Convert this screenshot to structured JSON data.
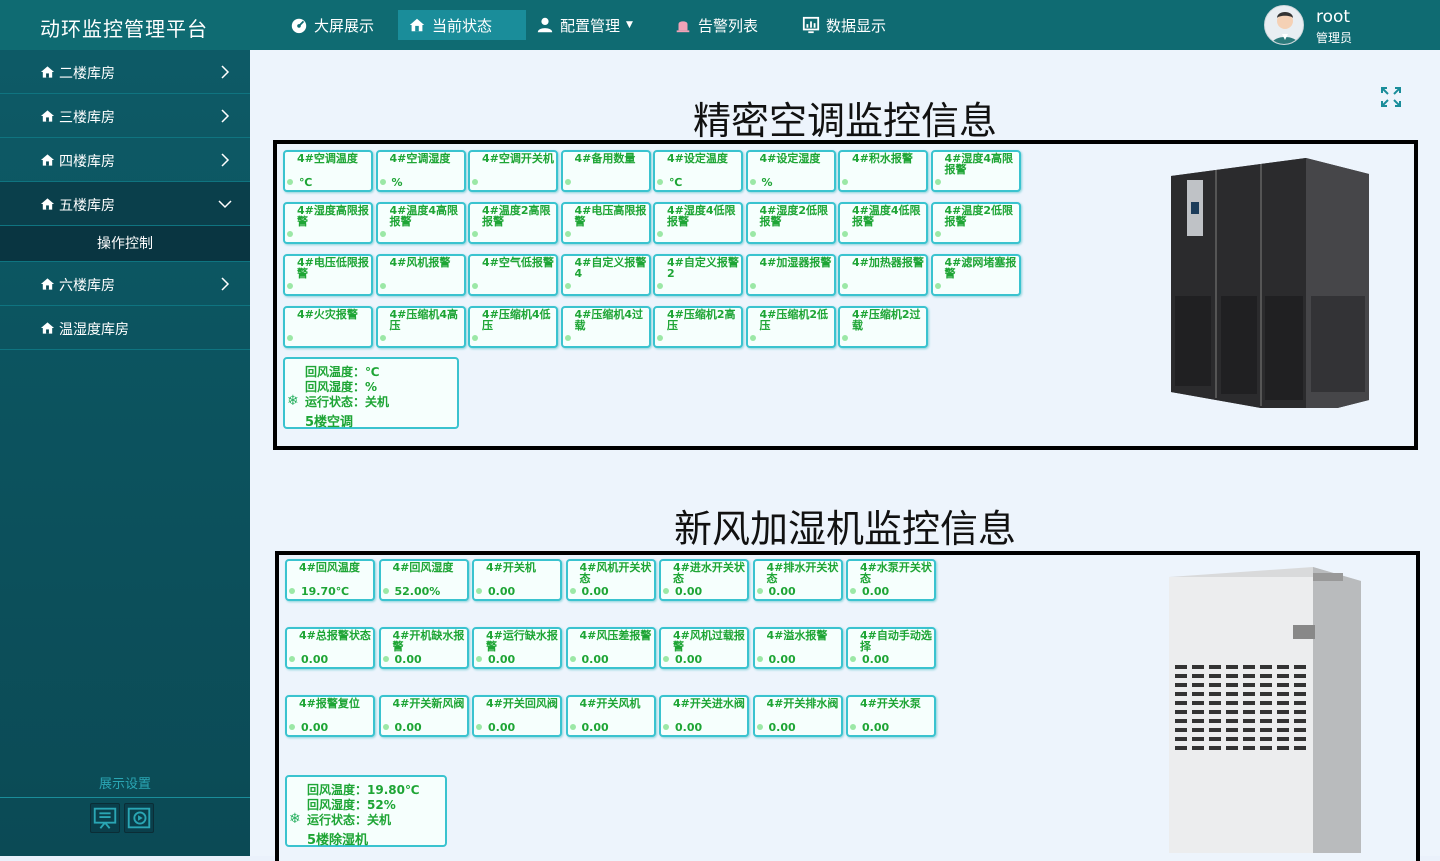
{
  "app": {
    "title": "动环监控管理平台"
  },
  "nav": [
    {
      "label": "大屏展示",
      "icon": "dashboard-icon"
    },
    {
      "label": "当前状态",
      "icon": "home-icon",
      "active": true
    },
    {
      "label": "配置管理",
      "icon": "user-icon",
      "dropdown": true
    },
    {
      "label": "告警列表",
      "icon": "alarm-icon"
    },
    {
      "label": "数据显示",
      "icon": "chart-icon"
    }
  ],
  "user": {
    "name": "root",
    "role": "管理员"
  },
  "sidebar": {
    "items": [
      {
        "label": "二楼库房"
      },
      {
        "label": "三楼库房"
      },
      {
        "label": "四楼库房"
      },
      {
        "label": "五楼库房",
        "expanded": true
      },
      {
        "label": "六楼库房"
      },
      {
        "label": "温湿度库房"
      }
    ],
    "submenu": "操作控制",
    "settings": "展示设置"
  },
  "ac": {
    "title": "精密空调监控信息",
    "cards": [
      {
        "name": "4#空调温度",
        "value": "℃"
      },
      {
        "name": "4#空调湿度",
        "value": "%"
      },
      {
        "name": "4#空调开关机",
        "value": ""
      },
      {
        "name": "4#备用数量",
        "value": ""
      },
      {
        "name": "4#设定温度",
        "value": "℃"
      },
      {
        "name": "4#设定湿度",
        "value": "%"
      },
      {
        "name": "4#积水报警",
        "value": ""
      },
      {
        "name": "4#湿度4高限报警",
        "value": ""
      },
      {
        "name": "4#湿度高限报警",
        "value": ""
      },
      {
        "name": "4#温度4高限报警",
        "value": ""
      },
      {
        "name": "4#温度2高限报警",
        "value": ""
      },
      {
        "name": "4#电压高限报警",
        "value": ""
      },
      {
        "name": "4#湿度4低限报警",
        "value": ""
      },
      {
        "name": "4#湿度2低限报警",
        "value": ""
      },
      {
        "name": "4#温度4低限报警",
        "value": ""
      },
      {
        "name": "4#温度2低限报警",
        "value": ""
      },
      {
        "name": "4#电压低限报警",
        "value": ""
      },
      {
        "name": "4#风机报警",
        "value": ""
      },
      {
        "name": "4#空气低报警",
        "value": ""
      },
      {
        "name": "4#自定义报警4",
        "value": ""
      },
      {
        "name": "4#自定义报警2",
        "value": ""
      },
      {
        "name": "4#加湿器报警",
        "value": ""
      },
      {
        "name": "4#加热器报警",
        "value": ""
      },
      {
        "name": "4#滤网堵塞报警",
        "value": ""
      },
      {
        "name": "4#火灾报警",
        "value": ""
      },
      {
        "name": "4#压缩机4高压",
        "value": ""
      },
      {
        "name": "4#压缩机4低压",
        "value": ""
      },
      {
        "name": "4#压缩机4过载",
        "value": ""
      },
      {
        "name": "4#压缩机2高压",
        "value": ""
      },
      {
        "name": "4#压缩机2低压",
        "value": ""
      },
      {
        "name": "4#压缩机2过载",
        "value": ""
      }
    ],
    "summary": {
      "line1": "回风温度：℃",
      "line2": "回风湿度：%",
      "line3": "运行状态：关机",
      "name": "5楼空调"
    }
  },
  "dh": {
    "title": "新风加湿机监控信息",
    "cards": [
      {
        "name": "4#回风温度",
        "value": "19.70℃"
      },
      {
        "name": "4#回风湿度",
        "value": "52.00%"
      },
      {
        "name": "4#开关机",
        "value": "0.00"
      },
      {
        "name": "4#风机开关状态",
        "value": "0.00"
      },
      {
        "name": "4#进水开关状态",
        "value": "0.00"
      },
      {
        "name": "4#排水开关状态",
        "value": "0.00"
      },
      {
        "name": "4#水泵开关状态",
        "value": "0.00"
      },
      {
        "name": "4#总报警状态",
        "value": "0.00"
      },
      {
        "name": "4#开机缺水报警",
        "value": "0.00"
      },
      {
        "name": "4#运行缺水报警",
        "value": "0.00"
      },
      {
        "name": "4#风压差报警",
        "value": "0.00"
      },
      {
        "name": "4#风机过载报警",
        "value": "0.00"
      },
      {
        "name": "4#溢水报警",
        "value": "0.00"
      },
      {
        "name": "4#自动手动选择",
        "value": "0.00"
      },
      {
        "name": "4#报警复位",
        "value": "0.00"
      },
      {
        "name": "4#开关新风阀",
        "value": "0.00"
      },
      {
        "name": "4#开关回风阀",
        "value": "0.00"
      },
      {
        "name": "4#开关风机",
        "value": "0.00"
      },
      {
        "name": "4#开关进水阀",
        "value": "0.00"
      },
      {
        "name": "4#开关排水阀",
        "value": "0.00"
      },
      {
        "name": "4#开关水泵",
        "value": "0.00"
      }
    ],
    "summary": {
      "line1": "回风温度：19.80℃",
      "line2": "回风湿度：52%",
      "line3": "运行状态：关机",
      "name": "5楼除湿机"
    }
  },
  "colors": {
    "topbar": "#0f6b72",
    "accent": "#1a8d9a",
    "card_text": "#1ea535",
    "card_border": "#3ac3cf"
  }
}
